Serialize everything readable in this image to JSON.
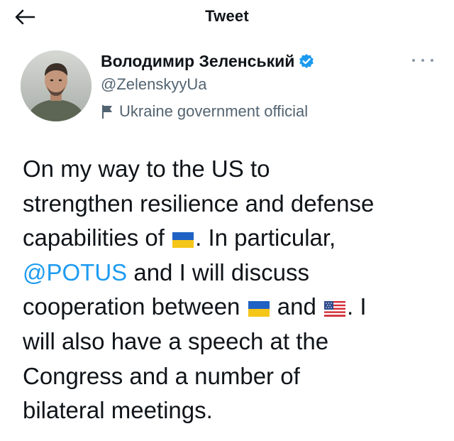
{
  "header": {
    "title": "Tweet",
    "back_icon": "arrow-left-icon"
  },
  "author": {
    "name": "Володимир Зеленський",
    "handle": "@ZelenskyyUa",
    "label": "Ukraine government official",
    "verified_icon": "verified-badge-icon",
    "label_icon": "flag-icon",
    "colors": {
      "verified": "#1d9bf0",
      "secondary_text": "#536471"
    }
  },
  "tweet": {
    "line1": "On my way to the US to",
    "line2": "strengthen resilience and defense",
    "line3_before": "capabilities of",
    "line3_after": ". In particular,",
    "mention": "@POTUS",
    "line4_after": " and I will discuss",
    "line5_before": "cooperation between",
    "line5_middle": "and",
    "line5_after": ". I",
    "line6": "will also have a speech at the",
    "line7": "Congress and a number of",
    "line8": "bilateral meetings.",
    "emojis": [
      "ukraine-flag-emoji",
      "ukraine-flag-emoji",
      "us-flag-emoji"
    ],
    "colors": {
      "text": "#0f1419",
      "mention": "#1d9bf0"
    }
  }
}
